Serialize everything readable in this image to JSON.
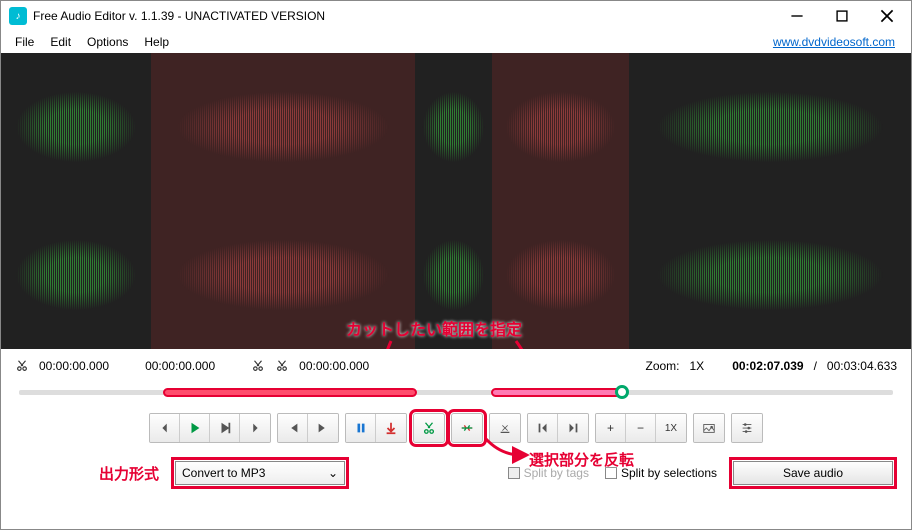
{
  "titlebar": {
    "app_title": "Free Audio Editor v. 1.1.39 - UNACTIVATED VERSION"
  },
  "menu": {
    "file": "File",
    "edit": "Edit",
    "options": "Options",
    "help": "Help",
    "site_link": "www.dvdvideosoft.com"
  },
  "time_row": {
    "cut_start": "00:00:00.000",
    "playhead": "00:00:00.000",
    "cut_end": "00:00:00.000",
    "zoom_label": "Zoom:",
    "zoom_value": "1X",
    "current_time": "00:02:07.039",
    "total_time": "00:03:04.633",
    "separator": "/"
  },
  "toolbar": {
    "play": "▶",
    "zoom_1x": "1X"
  },
  "annotations": {
    "range_label": "カットしたい範囲を指定",
    "invert_label": "選択部分を反転",
    "output_label": "出力形式"
  },
  "bottom": {
    "convert_value": "Convert to MP3",
    "split_tags": "Split by tags",
    "split_selections": "Split by selections",
    "save_label": "Save audio"
  }
}
